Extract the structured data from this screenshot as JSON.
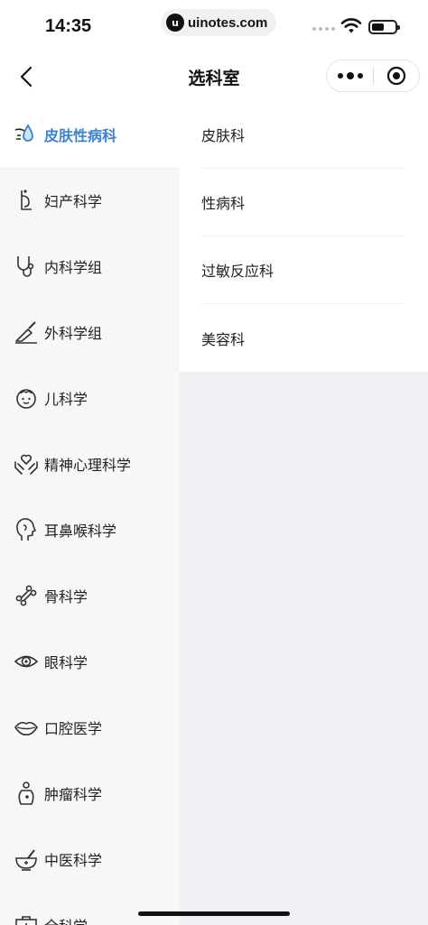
{
  "status_bar": {
    "time": "14:35",
    "watermark_logo": "u",
    "watermark_text": "uinotes.com"
  },
  "nav": {
    "title": "选科室",
    "back_icon": "chevron-left-icon",
    "more_icon": "more-dots-icon",
    "close_icon": "mini-program-close-icon"
  },
  "sidebar": {
    "items": [
      {
        "label": "皮肤性病科",
        "icon": "skin-droplet-icon",
        "active": true
      },
      {
        "label": "妇产科学",
        "icon": "pregnant-woman-icon",
        "active": false
      },
      {
        "label": "内科学组",
        "icon": "stethoscope-icon",
        "active": false
      },
      {
        "label": "外科学组",
        "icon": "scalpel-icon",
        "active": false
      },
      {
        "label": "儿科学",
        "icon": "child-face-icon",
        "active": false
      },
      {
        "label": "精神心理科学",
        "icon": "hands-heart-icon",
        "active": false
      },
      {
        "label": "耳鼻喉科学",
        "icon": "head-profile-icon",
        "active": false
      },
      {
        "label": "骨科学",
        "icon": "bone-icon",
        "active": false
      },
      {
        "label": "眼科学",
        "icon": "eye-icon",
        "active": false
      },
      {
        "label": "口腔医学",
        "icon": "lips-icon",
        "active": false
      },
      {
        "label": "肿瘤科学",
        "icon": "tumor-body-icon",
        "active": false
      },
      {
        "label": "中医科学",
        "icon": "mortar-pestle-icon",
        "active": false
      },
      {
        "label": "全科学",
        "icon": "medical-kit-icon",
        "active": false
      }
    ]
  },
  "sub_departments": [
    {
      "label": "皮肤科"
    },
    {
      "label": "性病科"
    },
    {
      "label": "过敏反应科"
    },
    {
      "label": "美容科"
    }
  ],
  "colors": {
    "accent": "#3b83d2",
    "sidebar_bg": "#f7f7f7",
    "content_bg": "#efeff4"
  }
}
